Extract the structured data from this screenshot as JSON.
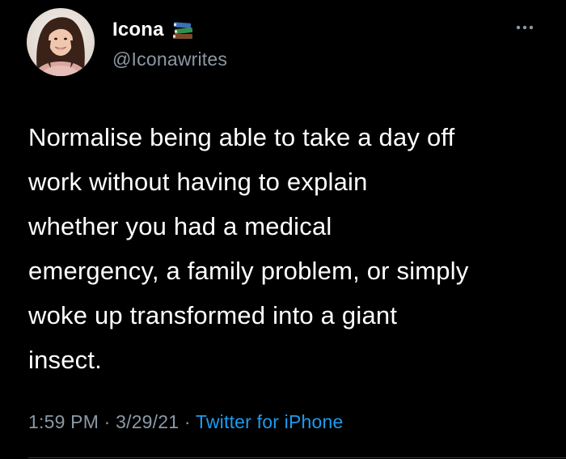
{
  "tweet": {
    "author": {
      "display_name": "Icona",
      "handle": "@Iconawrites",
      "name_emoji_icon": "books-icon",
      "avatar_icon": "profile-photo-avatar"
    },
    "more_icon": "more-horizontal-icon",
    "text_lines": [
      "Normalise being able to take a day off",
      "work without having to explain",
      "whether you had a medical",
      "emergency, a family problem, or simply",
      "woke up transformed into a giant",
      "insect."
    ],
    "meta": {
      "time": "1:59 PM",
      "separator": "·",
      "date": "3/29/21",
      "source": "Twitter for iPhone"
    },
    "colors": {
      "background": "#000000",
      "text": "#ffffff",
      "secondary_text": "#8b98a5",
      "link": "#1d9bf0"
    }
  }
}
